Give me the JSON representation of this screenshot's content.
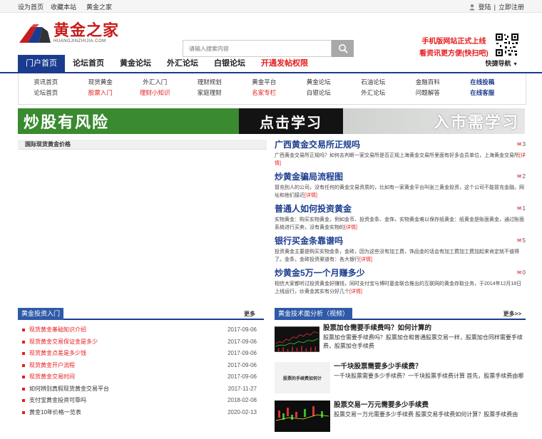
{
  "topbar": {
    "set_home": "设为首页",
    "bookmark": "收藏本站",
    "brand": "黄金之家",
    "login": "登陆",
    "register": "立即注册"
  },
  "header": {
    "logo_cn": "黄金之家",
    "logo_en": "HUANGJINZHIJIA.COM",
    "search_placeholder": "请输入搜索内容",
    "promo_line1": "手机版网站正式上线",
    "promo_line2": "看资讯更方便(快扫吧)"
  },
  "nav": {
    "items": [
      {
        "label": "门户首页"
      },
      {
        "label": "论坛首页"
      },
      {
        "label": "黄金论坛"
      },
      {
        "label": "外汇论坛"
      },
      {
        "label": "白银论坛"
      },
      {
        "label": "开通发帖权限"
      }
    ],
    "quick": "快捷导航"
  },
  "subnav": {
    "row1": [
      "资讯首页",
      "现货黄金",
      "外汇入门",
      "理财规划",
      "黄金平台",
      "黄金论坛",
      "石油论坛",
      "金融百科",
      "在线投稿"
    ],
    "row2": [
      "论坛首页",
      "股票入门",
      "理财小知识",
      "家庭理财",
      "名家专栏",
      "白银论坛",
      "外汇论坛",
      "问题解答",
      "在线客服"
    ]
  },
  "banner": {
    "left": "炒股有风险",
    "middle": "点击学习",
    "right": "入市需学习"
  },
  "price_panel": {
    "title": "国际现货黄金价格"
  },
  "news": [
    {
      "title": "广西黄金交易所正规吗",
      "desc": "广西黄金交易所正规吗？如何去判断一家交易所是否正规上海黄金交易所里面有好多会员单位，上海黄金交易所",
      "more": "[详情]",
      "count": "3"
    },
    {
      "title": "炒黄金骗局流程图",
      "desc": "冒充别人的公司，没有任何的黄金交易资质的，比如有一家黄金平台叫张三黄金投资，这个公司不能冒充金融，网址和他们接近",
      "more": "[详情]",
      "count": "2"
    },
    {
      "title": "普通人如何投资黄金",
      "desc": "实物黄金：购买实物黄金，例如金币、投资金条、金饰，实物黄金难以保存纸黄金：纸黄金是账面黄金，通过账面系统进行买卖，没有黄金实物的",
      "more": "[详情]",
      "count": "1"
    },
    {
      "title": "银行买金条靠谱吗",
      "desc": "投资黄金主要是购买实物金条，金砖，因为这些没有加工费，饰品金的话会有加工费加工费加起来肯定就不值得了。金条，金砖投资渠道有：各大银行",
      "more": "[详情]",
      "count": "5"
    },
    {
      "title": "炒黄金5万一个月赚多少",
      "desc": "相信大家都听过投资黄金好赚钱，同时支付宝与博时基金联合推出的互联网的黄金存取业务，于2014年12月18日上线运行，炒黄金其实有分好几个",
      "more": "[详情]",
      "count": "0"
    }
  ],
  "section_left": {
    "tab": "黄金投资入门",
    "more": "更多",
    "items": [
      {
        "text": "现货黄金基础知识介绍",
        "date": "2017-09-06",
        "red": true
      },
      {
        "text": "现货黄金交易保证金是多少",
        "date": "2017-09-06",
        "red": true
      },
      {
        "text": "现货黄金点差是多少钱",
        "date": "2017-09-06",
        "red": true
      },
      {
        "text": "现货黄金开户流程",
        "date": "2017-09-06",
        "red": true
      },
      {
        "text": "现货黄金交易时间",
        "date": "2017-09-06",
        "red": true
      },
      {
        "text": "如何辨别真假现货黄金交易平台",
        "date": "2017-11-27",
        "red": false
      },
      {
        "text": "支付宝黄金投资可靠吗",
        "date": "2018-02-08",
        "red": false
      },
      {
        "text": "黄金10年价格一览表",
        "date": "2020-02-13",
        "red": false
      }
    ]
  },
  "section_right": {
    "tab": "黄金技术面分析（视频）",
    "more": "更多>>",
    "items": [
      {
        "title": "股票加仓需要手续费吗？如何计算的",
        "desc": "股票加仓需要手续费吗？股票加仓和普通股票交易一样，股票加仓同样需要手续费，股票加仓手续费"
      },
      {
        "title": "一千块股票需要多少手续费？",
        "desc": "一千块股票需要多少手续费？一千块股票手续费计算 首先，股票手续费由哪",
        "thumb_label": "股票的手续费如何计"
      },
      {
        "title": "股票交易一万元需要多少手续费",
        "desc": "股票交易一万元需要多少手续费 股票交易手续费如何计算？股票手续费由"
      }
    ]
  },
  "colors": {
    "brand_blue": "#1b3c8e",
    "accent_red": "#e41c1c"
  }
}
